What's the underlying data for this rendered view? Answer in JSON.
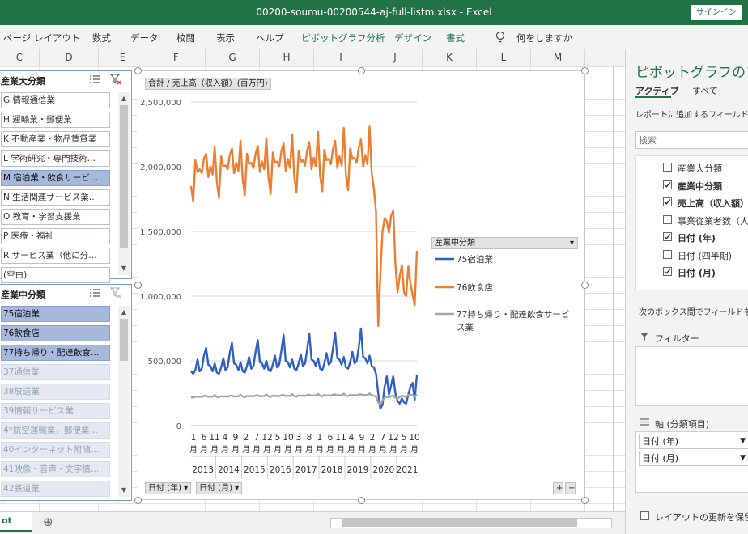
{
  "window": {
    "title": "00200-soumu-00200544-aj-full-listm.xlsx  -  Excel",
    "signin": "サインイン"
  },
  "ribbon": {
    "tabs": [
      "ページ レイアウト",
      "数式",
      "データ",
      "校閲",
      "表示",
      "ヘルプ"
    ],
    "context_tabs": [
      "ピボットグラフ分析",
      "デザイン",
      "書式"
    ],
    "tell_me": "何をしますか"
  },
  "columns": [
    "C",
    "D",
    "E",
    "F",
    "G",
    "H",
    "I",
    "J",
    "K",
    "L",
    "M"
  ],
  "slicer1": {
    "title": "産業大分類",
    "items": [
      {
        "label": "G 情報通信業",
        "state": "normal"
      },
      {
        "label": "H 運輸業・郵便業",
        "state": "normal"
      },
      {
        "label": "K 不動産業・物品賃貸業",
        "state": "normal"
      },
      {
        "label": "L 学術研究・専門技術…",
        "state": "normal"
      },
      {
        "label": "M 宿泊業・飲食サービ…",
        "state": "sel"
      },
      {
        "label": "N 生活関連サービス業…",
        "state": "normal"
      },
      {
        "label": "O 教育・学習支援業",
        "state": "normal"
      },
      {
        "label": "P 医療・福祉",
        "state": "normal"
      },
      {
        "label": "R サービス業（他に分…",
        "state": "normal"
      },
      {
        "label": "(空白)",
        "state": "normal"
      }
    ]
  },
  "slicer2": {
    "title": "産業中分類",
    "items": [
      {
        "label": "75宿泊業",
        "state": "sel"
      },
      {
        "label": "76飲食店",
        "state": "sel"
      },
      {
        "label": "77持ち帰り・配達飲食…",
        "state": "sel"
      },
      {
        "label": "37通信業",
        "state": "nodata"
      },
      {
        "label": "38放送業",
        "state": "nodata"
      },
      {
        "label": "39情報サービス業",
        "state": "nodata"
      },
      {
        "label": "4*航空運輸業，郵便業…",
        "state": "nodata"
      },
      {
        "label": "40インターネット附随…",
        "state": "nodata"
      },
      {
        "label": "41映像・音声・文字情…",
        "state": "nodata"
      },
      {
        "label": "42鉄道業",
        "state": "nodata"
      }
    ]
  },
  "chart_buttons": {
    "values_field": "合計 / 売上高（収入額）(百万円)",
    "axis_field1": "日付 (年)",
    "axis_field2": "日付 (月)",
    "zoom_plus": "+",
    "zoom_minus": "−"
  },
  "chart_data": {
    "type": "line",
    "ylim": [
      0,
      2500000
    ],
    "yticks": [
      0,
      500000,
      1000000,
      1500000,
      2000000,
      2500000
    ],
    "ytick_labels": [
      "0",
      "500,000",
      "1,000,000",
      "1,500,000",
      "2,000,000",
      "2,500,000"
    ],
    "year_labels": [
      "2013",
      "2014",
      "2015",
      "2016",
      "2017",
      "2018",
      "2019",
      "2020",
      "2021"
    ],
    "month_tick_labels": [
      "1",
      "6",
      "11",
      "4",
      "9",
      "2",
      "7",
      "12",
      "5",
      "10",
      "3",
      "8",
      "1",
      "6",
      "11",
      "4",
      "9",
      "2",
      "7",
      "12",
      "5",
      "10"
    ],
    "month_unit": "月",
    "x_start": "2013-01",
    "x_end": "2021-10",
    "legend_title": "産業中分類",
    "series": [
      {
        "name": "75宿泊業",
        "color": "#2f5ec4",
        "values": [
          420000,
          400000,
          430000,
          510000,
          420000,
          440000,
          540000,
          600000,
          470000,
          460000,
          420000,
          480000,
          410000,
          400000,
          450000,
          520000,
          430000,
          450000,
          560000,
          640000,
          480000,
          470000,
          430000,
          490000,
          420000,
          410000,
          460000,
          530000,
          440000,
          460000,
          570000,
          660000,
          490000,
          480000,
          440000,
          500000,
          430000,
          420000,
          470000,
          540000,
          450000,
          470000,
          580000,
          700000,
          500000,
          490000,
          450000,
          510000,
          440000,
          430000,
          480000,
          550000,
          460000,
          480000,
          590000,
          710000,
          510000,
          500000,
          460000,
          520000,
          440000,
          430000,
          480000,
          560000,
          470000,
          490000,
          600000,
          720000,
          520000,
          510000,
          470000,
          530000,
          450000,
          440000,
          490000,
          570000,
          480000,
          500000,
          610000,
          750000,
          530000,
          520000,
          480000,
          540000,
          460000,
          450000,
          400000,
          250000,
          130000,
          160000,
          300000,
          380000,
          240000,
          310000,
          380000,
          250000,
          190000,
          170000,
          210000,
          180000,
          170000,
          240000,
          300000,
          330000,
          200000,
          390000
        ]
      },
      {
        "name": "76飲食店",
        "color": "#ed7d31",
        "values": [
          1850000,
          1730000,
          2050000,
          1960000,
          1980000,
          1950000,
          2060000,
          2100000,
          1920000,
          2000000,
          1940000,
          2150000,
          1880000,
          1760000,
          2080000,
          2000000,
          2010000,
          1980000,
          2090000,
          2140000,
          1950000,
          2030000,
          1970000,
          2200000,
          1900000,
          1780000,
          2100000,
          2020000,
          2030000,
          1990000,
          2100000,
          2160000,
          1960000,
          2040000,
          1980000,
          2220000,
          1910000,
          1790000,
          2110000,
          2030000,
          2040000,
          2000000,
          2120000,
          2180000,
          1970000,
          2060000,
          1990000,
          2250000,
          1920000,
          1800000,
          2120000,
          2040000,
          2050000,
          2010000,
          2130000,
          2190000,
          1980000,
          2070000,
          2000000,
          2270000,
          1930000,
          1810000,
          2130000,
          2050000,
          2060000,
          2020000,
          2140000,
          2200000,
          1990000,
          2080000,
          2010000,
          2300000,
          1940000,
          1820000,
          2140000,
          2060000,
          2070000,
          2030000,
          2150000,
          2210000,
          2000000,
          2090000,
          2020000,
          2310000,
          1950000,
          1830000,
          1650000,
          770000,
          1150000,
          1500000,
          1600000,
          1580000,
          1490000,
          1620000,
          1660000,
          1250000,
          1030000,
          1150000,
          1240000,
          1030000,
          1000000,
          1230000,
          1100000,
          1010000,
          930000,
          1350000
        ]
      },
      {
        "name": "77持ち帰り・配達飲食サービス業",
        "color": "#a5a5a5",
        "values": [
          220000,
          215000,
          225000,
          222000,
          224000,
          221000,
          228000,
          230000,
          222000,
          225000,
          223000,
          235000,
          222000,
          218000,
          228000,
          224000,
          226000,
          223000,
          230000,
          232000,
          224000,
          227000,
          225000,
          238000,
          224000,
          220000,
          230000,
          226000,
          228000,
          225000,
          232000,
          234000,
          226000,
          229000,
          227000,
          240000,
          226000,
          222000,
          232000,
          228000,
          230000,
          227000,
          234000,
          236000,
          228000,
          231000,
          229000,
          242000,
          228000,
          224000,
          234000,
          230000,
          232000,
          229000,
          236000,
          238000,
          230000,
          233000,
          231000,
          244000,
          230000,
          226000,
          236000,
          232000,
          234000,
          231000,
          238000,
          240000,
          232000,
          235000,
          233000,
          246000,
          232000,
          228000,
          238000,
          234000,
          236000,
          233000,
          240000,
          242000,
          234000,
          237000,
          235000,
          248000,
          234000,
          230000,
          222000,
          180000,
          160000,
          195000,
          215000,
          222000,
          218000,
          228000,
          232000,
          215000,
          208000,
          220000,
          232000,
          225000,
          222000,
          236000,
          238000,
          234000,
          222000,
          240000
        ]
      }
    ]
  },
  "sheet_tab": "ot",
  "add_sheet": "⊕",
  "pane": {
    "title": "ピボットグラフのフィ",
    "tabs": [
      "アクティブ",
      "すべて"
    ],
    "instruction": "レポートに追加するフィールドを選",
    "search_placeholder": "検索",
    "fields": [
      {
        "label": "産業大分類",
        "checked": false
      },
      {
        "label": "産業中分類",
        "checked": true
      },
      {
        "label": "売上高（収入額）",
        "checked": true
      },
      {
        "label": "事業従業者数（人",
        "checked": false
      },
      {
        "label": "日付 (年)",
        "checked": true
      },
      {
        "label": "日付 (四半期)",
        "checked": false
      },
      {
        "label": "日付 (月)",
        "checked": true
      }
    ],
    "drag_hint": "次のボックス間でフィールドをドラ",
    "filters_label": "フィルター",
    "axis_label": "軸 (分類項目)",
    "axis_items": [
      "日付 (年)",
      "日付 (月)"
    ],
    "defer_label": "レイアウトの更新を保留す"
  }
}
